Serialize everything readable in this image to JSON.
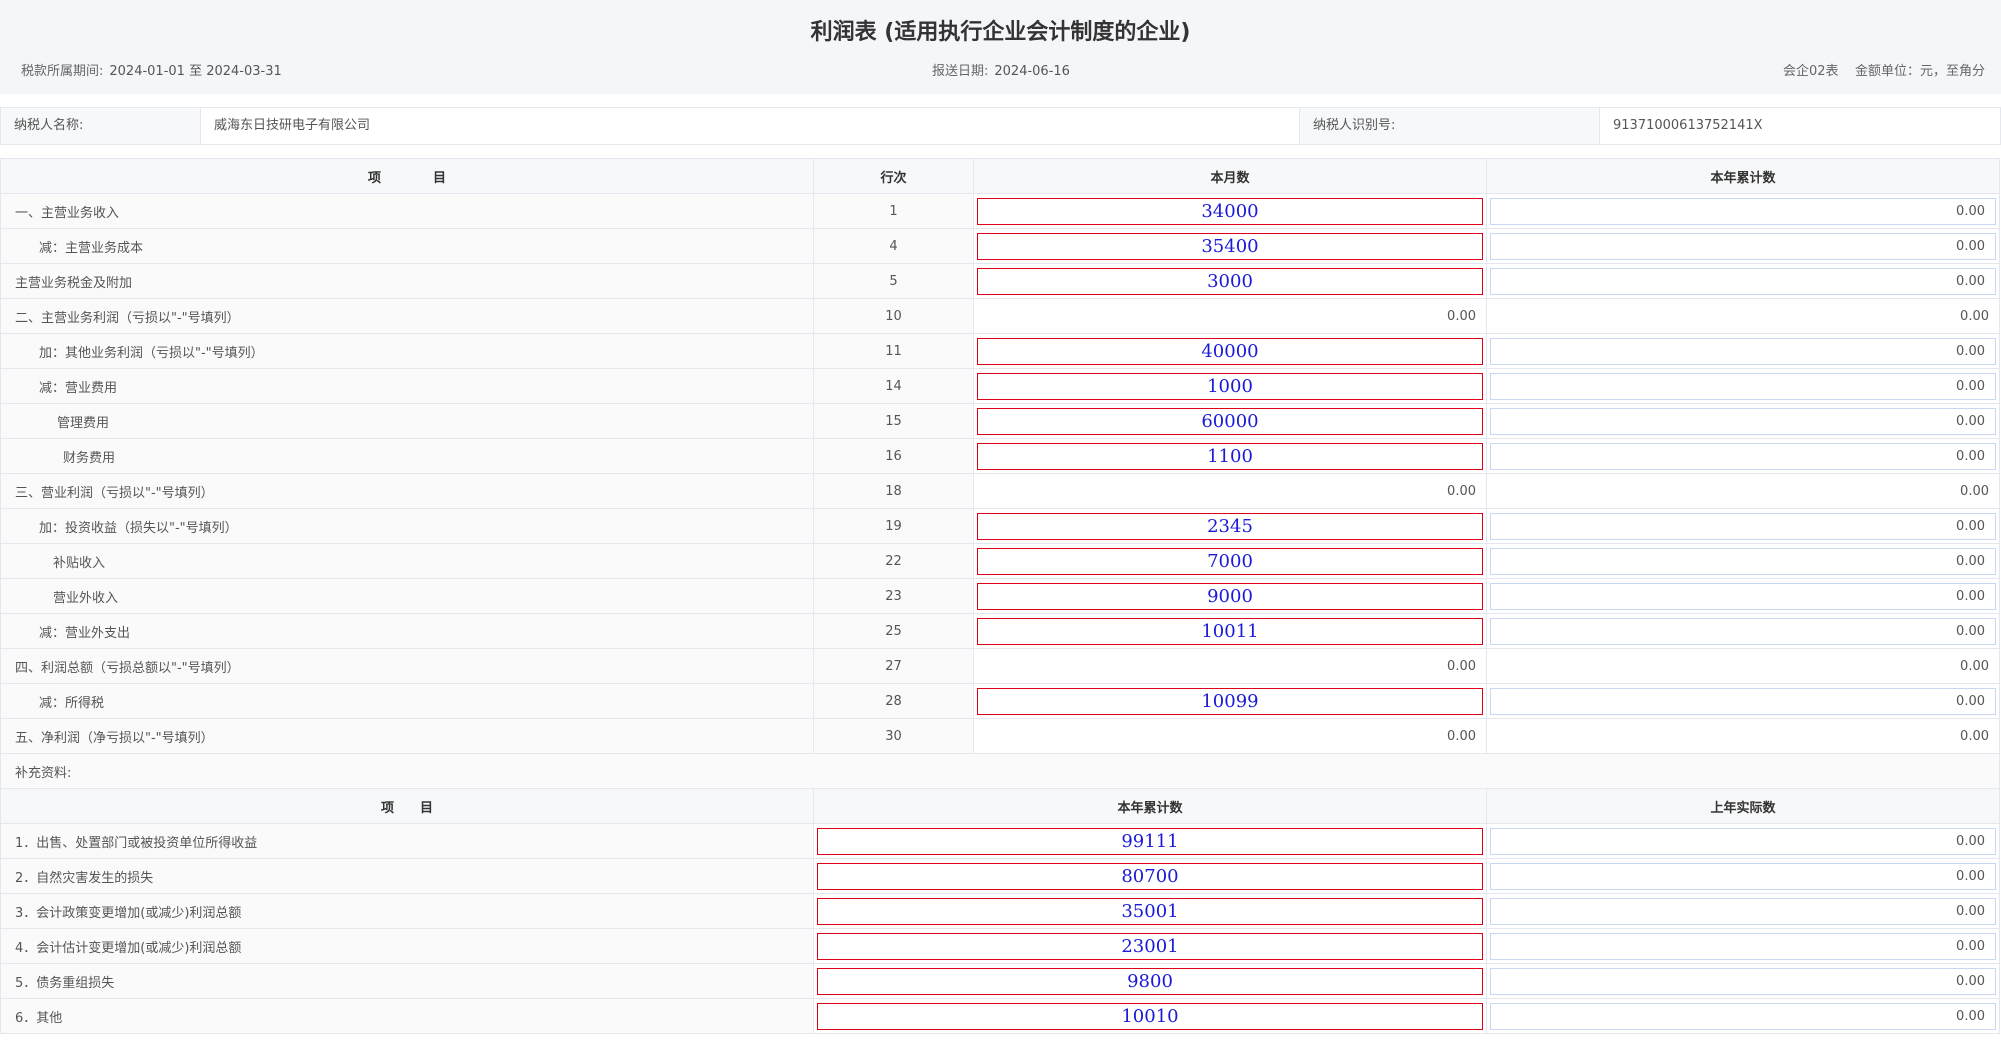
{
  "title": "利润表 (适用执行企业会计制度的企业)",
  "period": {
    "label": "税款所属期间:",
    "value": "2024-01-01  至  2024-03-31"
  },
  "report_date": {
    "label": "报送日期:",
    "value": "2024-06-16"
  },
  "form_code": "会企02表",
  "unit": "金额单位：元，至角分",
  "taxpayer": {
    "name_label": "纳税人名称:",
    "name": "威海东日技研电子有限公司",
    "id_label": "纳税人识别号:",
    "id": "91371000613752141X"
  },
  "main_table": {
    "headers": [
      "项　　　　目",
      "行次",
      "本月数",
      "本年累计数"
    ],
    "rows": [
      {
        "item": "一、主营业务收入",
        "line": "1",
        "month": "34000",
        "year": "0.00"
      },
      {
        "item": "减：主营业务成本",
        "line": "4",
        "month": "35400",
        "year": "0.00"
      },
      {
        "item": "主营业务税金及附加",
        "line": "5",
        "month": "3000",
        "year": "0.00"
      },
      {
        "item": "二、主营业务利润（亏损以\"-\"号填列）",
        "line": "10",
        "month": "0.00",
        "year": "0.00"
      },
      {
        "item": "加：其他业务利润（亏损以\"-\"号填列）",
        "line": "11",
        "month": "40000",
        "year": "0.00"
      },
      {
        "item": "减：营业费用",
        "line": "14",
        "month": "1000",
        "year": "0.00"
      },
      {
        "item": "管理费用",
        "line": "15",
        "month": "60000",
        "year": "0.00"
      },
      {
        "item": "财务费用",
        "line": "16",
        "month": "1100",
        "year": "0.00"
      },
      {
        "item": "三、营业利润（亏损以\"-\"号填列）",
        "line": "18",
        "month": "0.00",
        "year": "0.00"
      },
      {
        "item": "加：投资收益（损失以\"-\"号填列）",
        "line": "19",
        "month": "2345",
        "year": "0.00"
      },
      {
        "item": "补贴收入",
        "line": "22",
        "month": "7000",
        "year": "0.00"
      },
      {
        "item": "营业外收入",
        "line": "23",
        "month": "9000",
        "year": "0.00"
      },
      {
        "item": "减：营业外支出",
        "line": "25",
        "month": "10011",
        "year": "0.00"
      },
      {
        "item": "四、利润总额（亏损总额以\"-\"号填列）",
        "line": "27",
        "month": "0.00",
        "year": "0.00"
      },
      {
        "item": "减：所得税",
        "line": "28",
        "month": "10099",
        "year": "0.00"
      },
      {
        "item": "五、净利润（净亏损以\"-\"号填列）",
        "line": "30",
        "month": "0.00",
        "year": "0.00"
      }
    ]
  },
  "supplement": {
    "label": "补充资料:",
    "headers": [
      "项　　目",
      "本年累计数",
      "上年实际数"
    ],
    "rows": [
      {
        "item": "1．出售、处置部门或被投资单位所得收益",
        "current": "99111",
        "prior": "0.00"
      },
      {
        "item": "2．自然灾害发生的损失",
        "current": "80700",
        "prior": "0.00"
      },
      {
        "item": "3．会计政策变更增加(或减少)利润总额",
        "current": "35001",
        "prior": "0.00"
      },
      {
        "item": "4．会计估计变更增加(或减少)利润总额",
        "current": "23001",
        "prior": "0.00"
      },
      {
        "item": "5．债务重组损失",
        "current": "9800",
        "prior": "0.00"
      },
      {
        "item": "6．其他",
        "current": "10010",
        "prior": "0.00"
      }
    ]
  }
}
